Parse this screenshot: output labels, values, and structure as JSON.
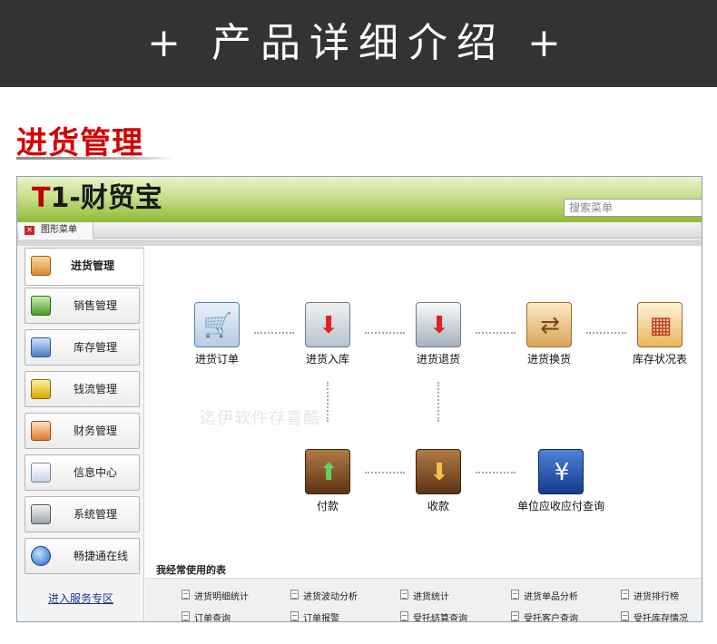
{
  "banner": {
    "title": "+ 产品详细介绍 +"
  },
  "section": {
    "title": "进货管理"
  },
  "app": {
    "logo_t": "T",
    "logo_rest": "1-财贸宝",
    "search_placeholder": "搜索菜单",
    "tab_label": "图形菜单"
  },
  "sidebar": {
    "items": [
      {
        "label": "进货管理",
        "icon": "purchase-icon"
      },
      {
        "label": "销售管理",
        "icon": "basket-icon"
      },
      {
        "label": "库存管理",
        "icon": "warehouse-icon"
      },
      {
        "label": "钱流管理",
        "icon": "money-icon"
      },
      {
        "label": "财务管理",
        "icon": "finance-icon"
      },
      {
        "label": "信息中心",
        "icon": "mail-icon"
      },
      {
        "label": "系统管理",
        "icon": "settings-icon"
      },
      {
        "label": "畅捷通在线",
        "icon": "globe-icon"
      }
    ],
    "service_link": "进入服务专区"
  },
  "functions": [
    {
      "label": "进货订单",
      "icon": "cart-order-icon"
    },
    {
      "label": "进货入库",
      "icon": "stock-in-icon"
    },
    {
      "label": "进货退货",
      "icon": "return-icon"
    },
    {
      "label": "进货换货",
      "icon": "exchange-icon"
    },
    {
      "label": "库存状况表",
      "icon": "clipboard-icon"
    },
    {
      "label": "付款",
      "icon": "payment-icon"
    },
    {
      "label": "收款",
      "icon": "receipt-icon"
    },
    {
      "label": "单位应收应付查询",
      "icon": "magnifier-yen-icon"
    }
  ],
  "watermark": "迄伊软件存喜酷",
  "frequent": {
    "title": "我经常使用的表",
    "row1": [
      "进货明细统计",
      "进货波动分析",
      "进货统计",
      "进货单品分析",
      "进货排行榜"
    ],
    "row2": [
      "订单查询",
      "订单报警",
      "受托结算查询",
      "受托客户查询",
      "受托库存情况"
    ]
  },
  "colors": {
    "banner_bg": "#333333",
    "section_title": "#d40000",
    "header_green": "#8fba36",
    "link_blue": "#1a3a8a"
  }
}
